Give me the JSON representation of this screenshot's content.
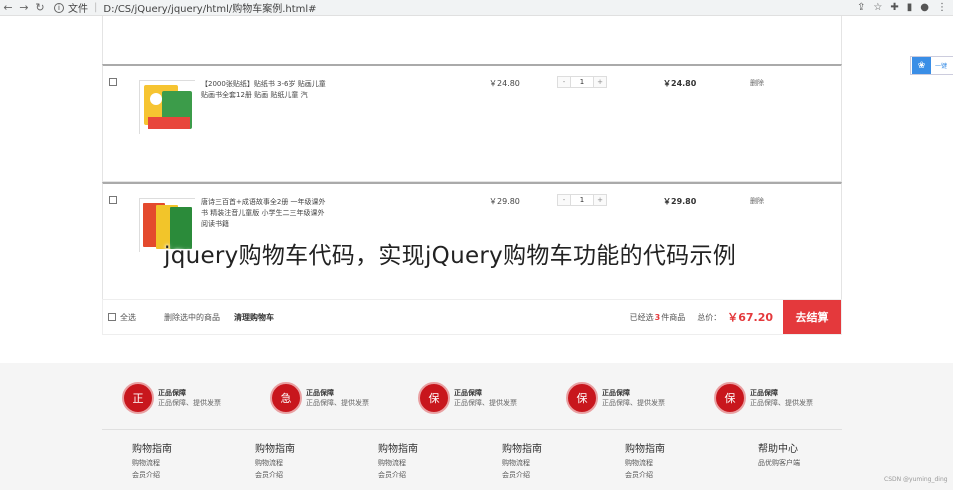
{
  "browser": {
    "back": "←",
    "forward": "→",
    "reload": "↻",
    "file_label": "文件",
    "url": "D:/CS/jQuery/jquery/html/购物车案例.html#",
    "icons": {
      "share": "⇪",
      "star": "☆",
      "extension": "✚",
      "sidebar": "▮",
      "profile": "●",
      "menu": "⋮"
    }
  },
  "cart": {
    "items": [
      {
        "title": "【2000张贴纸】贴纸书 3-6岁 贴画儿童 贴画书全套12册 贴画 贴纸儿童 汽",
        "price": "￥24.80",
        "minus": "-",
        "qty": "1",
        "plus": "+",
        "subtotal": "￥24.80",
        "delete": "删除",
        "thumb_colors": [
          "#e8463b",
          "#f6c431",
          "#3c9c4a",
          "#ffffff"
        ]
      },
      {
        "title": "唐诗三百首+成语故事全2册 一年级课外书 精装注音儿童版 小学生二三年级课外阅读书籍",
        "price": "￥29.80",
        "minus": "-",
        "qty": "1",
        "plus": "+",
        "subtotal": "￥29.80",
        "delete": "删除",
        "thumb_colors": [
          "#2b8b3a",
          "#f2c52a",
          "#e44a2d",
          "#ffffff"
        ]
      }
    ],
    "footer": {
      "select_all": "全选",
      "delete_selected": "删除选中的商品",
      "clear_cart": "清理购物车",
      "selected_prefix": "已经选",
      "selected_count": "3",
      "selected_suffix": "件商品",
      "total_label": "总价：",
      "total": "￥67.20",
      "checkout": "去结算"
    }
  },
  "watermark": "jquery购物车代码，实现jQuery购物车功能的代码示例",
  "side_widget": {
    "icon": "❀",
    "text": "一键"
  },
  "guarantees": [
    {
      "icon": "正",
      "title": "正品保障",
      "sub": "正品保障、提供发票"
    },
    {
      "icon": "急",
      "title": "正品保障",
      "sub": "正品保障、提供发票"
    },
    {
      "icon": "保",
      "title": "正品保障",
      "sub": "正品保障、提供发票"
    },
    {
      "icon": "保",
      "title": "正品保障",
      "sub": "正品保障、提供发票"
    },
    {
      "icon": "保",
      "title": "正品保障",
      "sub": "正品保障、提供发票"
    }
  ],
  "footer_cols": [
    {
      "title": "购物指南",
      "items": [
        "购物流程",
        "会员介绍"
      ]
    },
    {
      "title": "购物指南",
      "items": [
        "购物流程",
        "会员介绍"
      ]
    },
    {
      "title": "购物指南",
      "items": [
        "购物流程",
        "会员介绍"
      ]
    },
    {
      "title": "购物指南",
      "items": [
        "购物流程",
        "会员介绍"
      ]
    },
    {
      "title": "购物指南",
      "items": [
        "购物流程",
        "会员介绍"
      ]
    },
    {
      "title": "帮助中心",
      "items": [
        "",
        "品优购客户端"
      ]
    }
  ],
  "csdn_mark": "CSDN @yuming_ding"
}
